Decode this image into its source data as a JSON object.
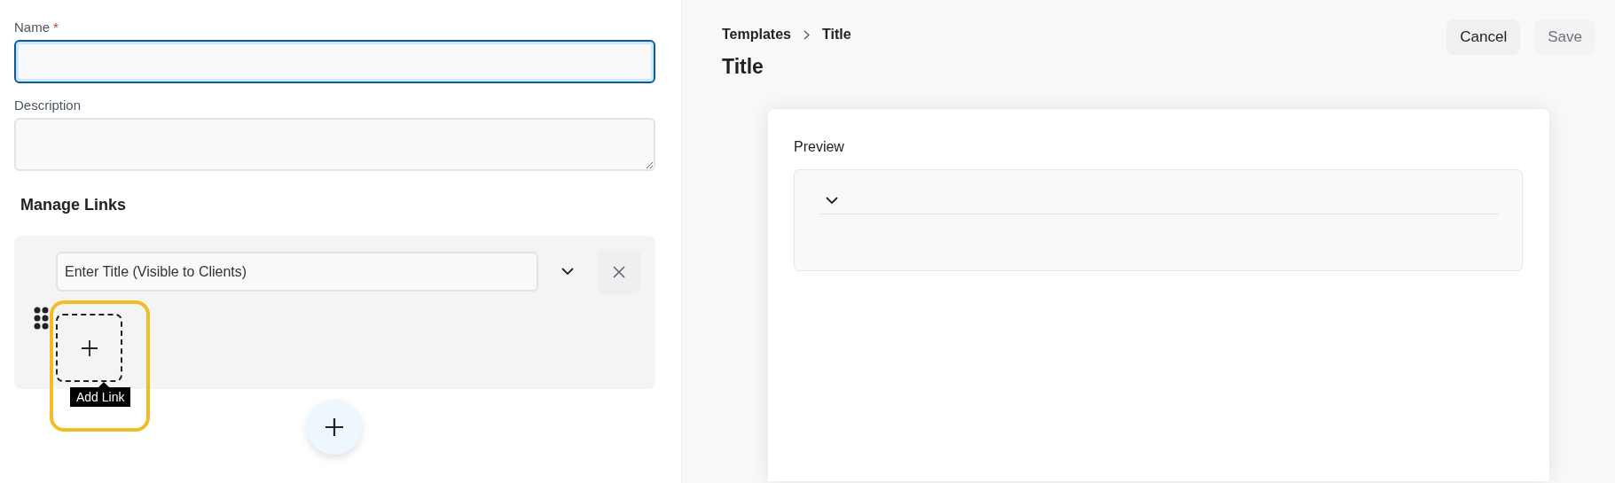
{
  "form": {
    "fields": [
      {
        "kind": "input",
        "label": "Name",
        "required_mark": "*",
        "focused": true
      },
      {
        "kind": "textarea",
        "label": "Description",
        "focused": false
      }
    ],
    "section_title": "Manage Links",
    "link_rows": [
      {
        "title_placeholder": "Enter Title (Visible to Clients)",
        "expanded": false,
        "add_tooltip": "Add Link"
      }
    ]
  },
  "header": {
    "breadcrumb": [
      "Templates",
      "Title"
    ],
    "title": "Title",
    "buttons": [
      {
        "label": "Cancel",
        "disabled": false
      },
      {
        "label": "Save",
        "disabled": true
      }
    ]
  },
  "preview": {
    "label": "Preview",
    "expanded": false
  }
}
